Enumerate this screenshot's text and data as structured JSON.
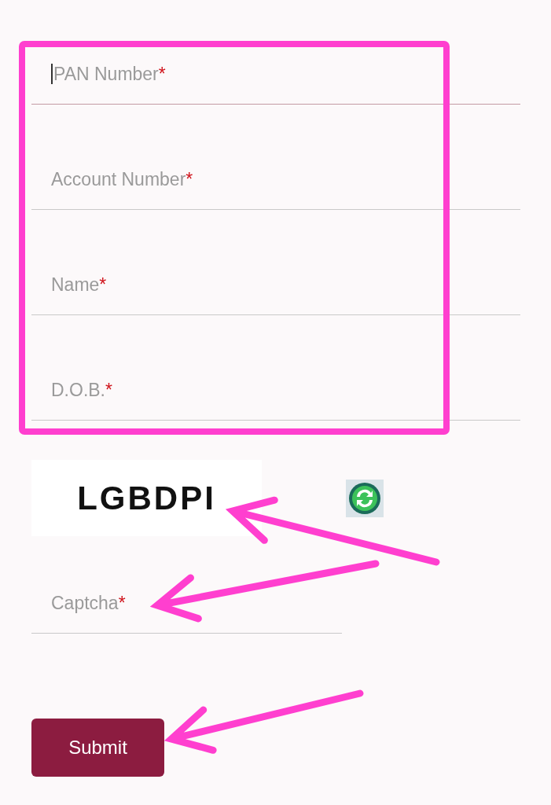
{
  "fields": [
    {
      "label": "PAN Number",
      "required_mark": "*",
      "focused": true
    },
    {
      "label": "Account Number",
      "required_mark": "*",
      "focused": false
    },
    {
      "label": "Name",
      "required_mark": "*",
      "focused": false
    },
    {
      "label": "D.O.B.",
      "required_mark": "*",
      "focused": false
    }
  ],
  "captcha": {
    "text": "LGBDPI",
    "field": {
      "label": "Captcha",
      "required_mark": "*",
      "focused": false
    }
  },
  "submit_button": "Submit"
}
